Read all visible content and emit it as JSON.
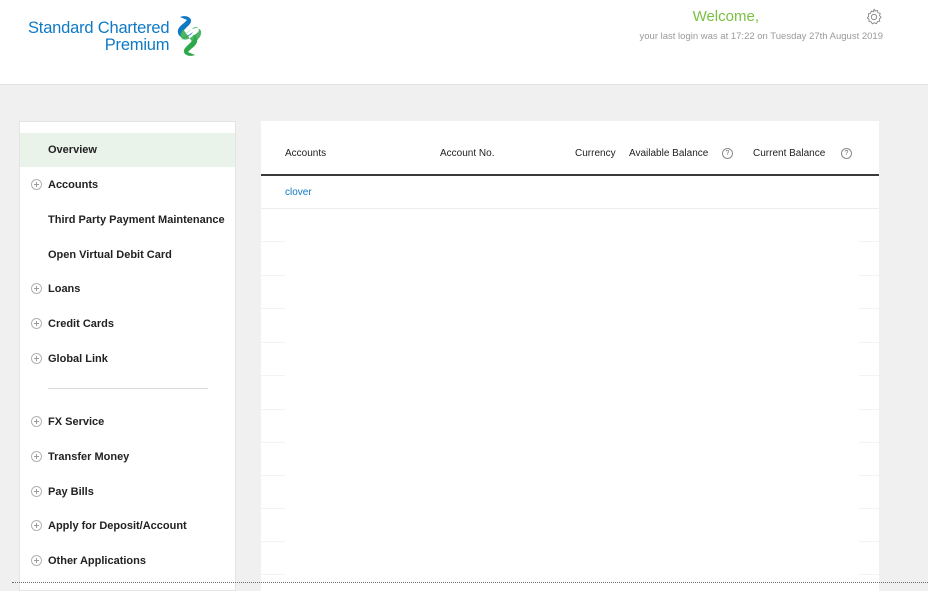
{
  "header": {
    "logo_line1": "Standard Chartered",
    "logo_line2": "Premium",
    "welcome": "Welcome,",
    "last_login": "your last login was at 17:22 on Tuesday 27th August 2019",
    "settings_icon": "gear-icon"
  },
  "sidebar": {
    "items": [
      {
        "label": "Overview",
        "expandable": false,
        "active": true
      },
      {
        "label": "Accounts",
        "expandable": true
      },
      {
        "label": "Third Party Payment Maintenance",
        "expandable": false
      },
      {
        "label": "Open Virtual Debit Card",
        "expandable": false
      },
      {
        "label": "Loans",
        "expandable": true
      },
      {
        "label": "Credit Cards",
        "expandable": true
      },
      {
        "label": "Global Link",
        "expandable": true
      },
      {
        "label": "FX Service",
        "expandable": true
      },
      {
        "label": "Transfer Money",
        "expandable": true
      },
      {
        "label": "Pay Bills",
        "expandable": true
      },
      {
        "label": "Apply for Deposit/Account",
        "expandable": true
      },
      {
        "label": "Other Applications",
        "expandable": true
      }
    ]
  },
  "table": {
    "headers": {
      "accounts": "Accounts",
      "account_no": "Account No.",
      "currency": "Currency",
      "available_balance": "Available Balance",
      "current_balance": "Current Balance"
    },
    "help_glyph": "?",
    "rows": [
      {
        "account": "clover",
        "account_no": "",
        "currency": "",
        "available_balance": "",
        "current_balance": ""
      }
    ]
  },
  "colors": {
    "brand_blue": "#0f79c5",
    "brand_green": "#7ac143",
    "active_bg": "#eaf3ea"
  }
}
